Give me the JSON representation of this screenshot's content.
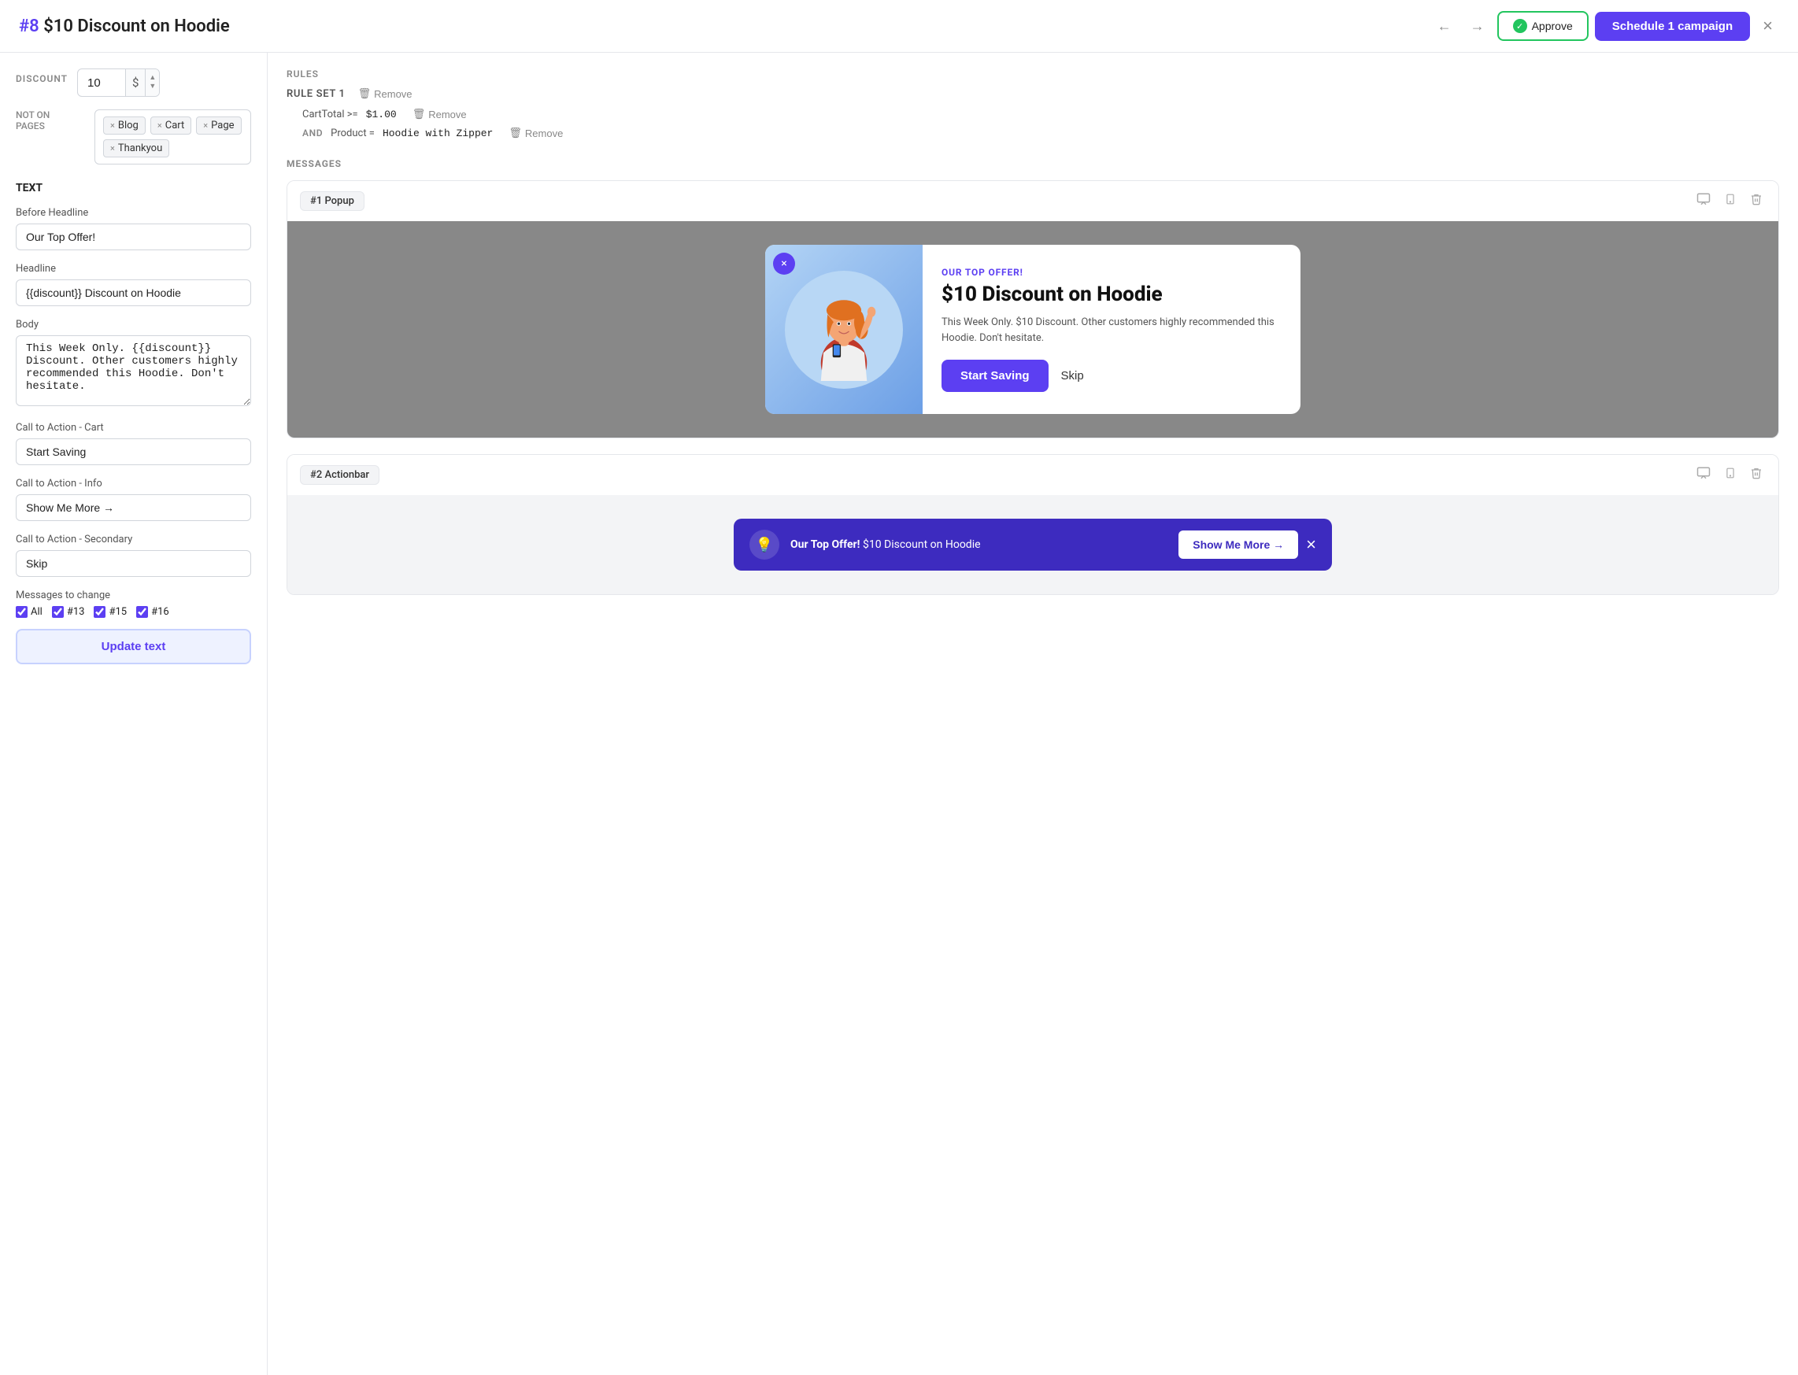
{
  "header": {
    "campaign_number": "#8",
    "campaign_title": "$10 Discount on Hoodie",
    "approve_label": "Approve",
    "schedule_label": "Schedule 1 campaign",
    "close_label": "×"
  },
  "left": {
    "discount_label": "DISCOUNT",
    "discount_value": "10",
    "discount_currency": "$",
    "not_on_pages_label": "NOT ON PAGES",
    "tags": [
      "Blog",
      "Cart",
      "Page",
      "Thankyou"
    ],
    "text_section_label": "TEXT",
    "before_headline_label": "Before Headline",
    "before_headline_value": "Our Top Offer!",
    "headline_label": "Headline",
    "headline_value": "{{discount}} Discount on Hoodie",
    "body_label": "Body",
    "body_value": "This Week Only. {{discount}} Discount. Other customers highly recommended this Hoodie. Don't hesitate.",
    "cta_cart_label": "Call to Action - Cart",
    "cta_cart_value": "Start Saving",
    "cta_info_label": "Call to Action - Info",
    "cta_info_value": "Show Me More →",
    "cta_secondary_label": "Call to Action - Secondary",
    "cta_secondary_value": "Skip",
    "messages_to_change_label": "Messages to change",
    "checkboxes": [
      {
        "id": "all",
        "label": "All",
        "checked": true
      },
      {
        "id": "13",
        "label": "#13",
        "checked": true
      },
      {
        "id": "15",
        "label": "#15",
        "checked": true
      },
      {
        "id": "16",
        "label": "#16",
        "checked": true
      }
    ],
    "update_btn_label": "Update text"
  },
  "rules": {
    "section_label": "RULES",
    "rule_set_label": "RULE SET 1",
    "remove_label": "Remove",
    "rules": [
      {
        "condition": "CartTotal >= $1.00",
        "has_and": false
      },
      {
        "prefix": "AND",
        "condition": "Product = Hoodie with Zipper",
        "has_and": true
      }
    ]
  },
  "messages": {
    "section_label": "MESSAGES",
    "cards": [
      {
        "id": "popup",
        "tag": "#1 Popup",
        "preview": {
          "pretitle": "OUR TOP OFFER!",
          "title": "$10 Discount on Hoodie",
          "body": "This Week Only. $10 Discount. Other customers highly recommended this Hoodie. Don't hesitate.",
          "cta": "Start Saving",
          "skip": "Skip"
        }
      },
      {
        "id": "actionbar",
        "tag": "#2 Actionbar",
        "preview": {
          "bold": "Our Top Offer!",
          "text": " $10 Discount on Hoodie",
          "cta": "Show Me More →"
        }
      }
    ]
  }
}
